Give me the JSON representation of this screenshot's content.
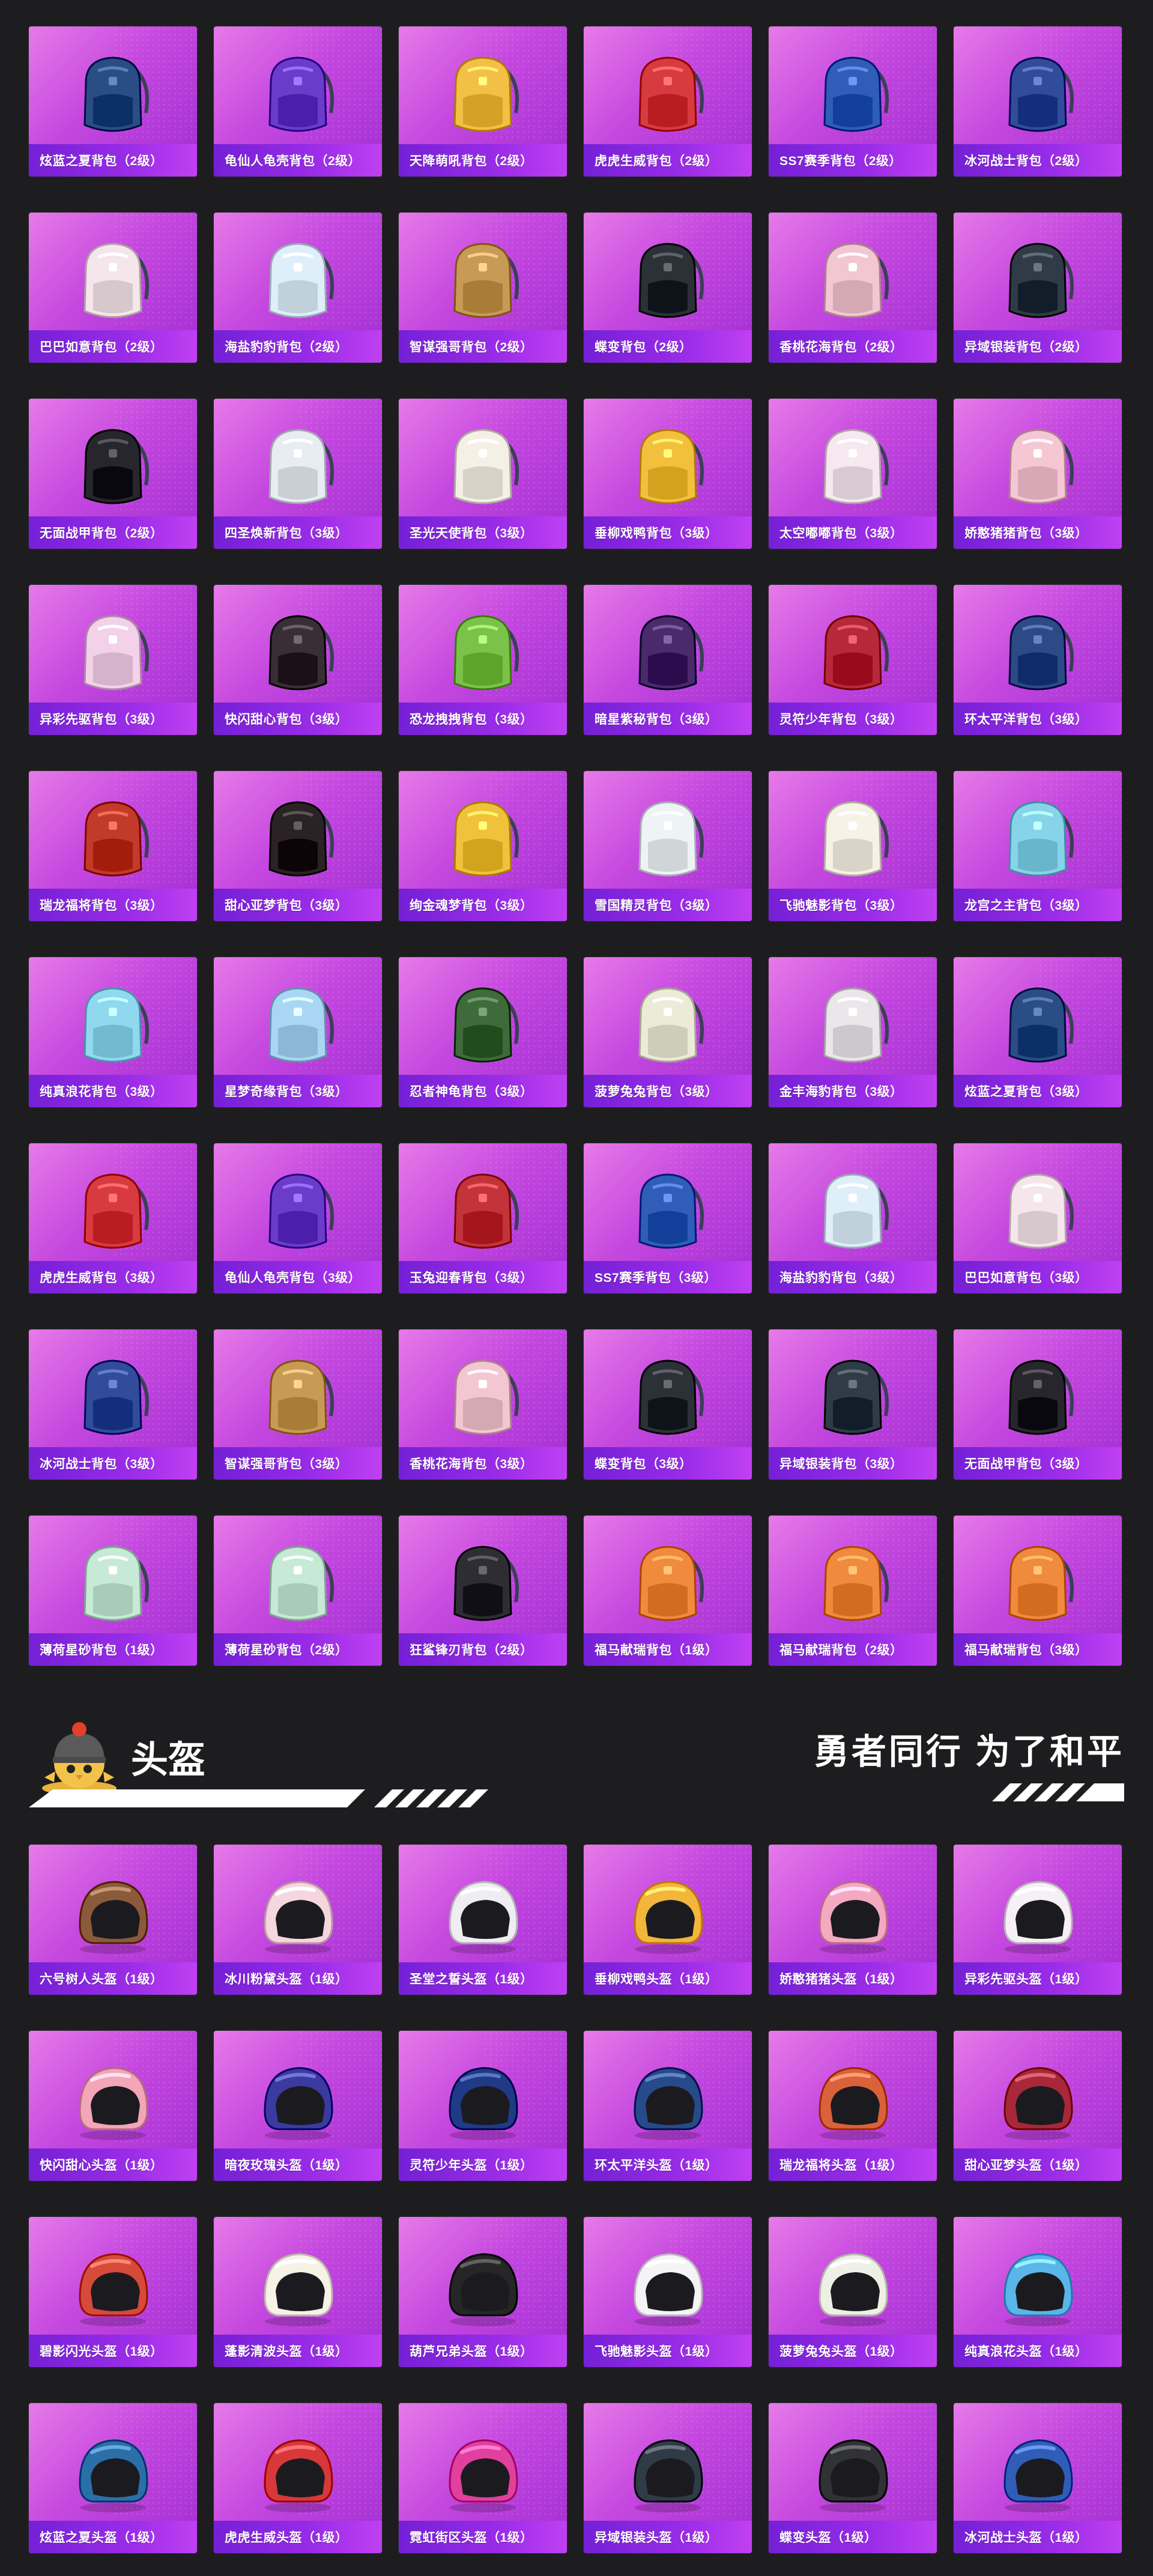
{
  "backpacks": [
    {
      "label": "炫蓝之夏背包（2级）",
      "icon": "backpack-icon",
      "color": "#2a4d86"
    },
    {
      "label": "龟仙人龟壳背包（2级）",
      "icon": "backpack-icon",
      "color": "#6a3cc9"
    },
    {
      "label": "天降萌吼背包（2级）",
      "icon": "backpack-icon",
      "color": "#f2c045"
    },
    {
      "label": "虎虎生威背包（2级）",
      "icon": "backpack-icon",
      "color": "#d83b3f"
    },
    {
      "label": "SS7赛季背包（2级）",
      "icon": "backpack-icon",
      "color": "#2f5db8"
    },
    {
      "label": "冰河战士背包（2级）",
      "icon": "backpack-icon",
      "color": "#314c9a"
    },
    {
      "label": "巴巴如意背包（2级）",
      "icon": "backpack-icon",
      "color": "#f4e6ea"
    },
    {
      "label": "海盐豹豹背包（2级）",
      "icon": "backpack-icon",
      "color": "#dfeffa"
    },
    {
      "label": "智谋强哥背包（2级）",
      "icon": "backpack-icon",
      "color": "#c79a55"
    },
    {
      "label": "蝶变背包（2级）",
      "icon": "backpack-icon",
      "color": "#2c3037"
    },
    {
      "label": "香桃花海背包（2级）",
      "icon": "backpack-icon",
      "color": "#f2c7d2"
    },
    {
      "label": "异域银装背包（2级）",
      "icon": "backpack-icon",
      "color": "#2f3b46"
    },
    {
      "label": "无面战甲背包（2级）",
      "icon": "backpack-icon",
      "color": "#26262c"
    },
    {
      "label": "四圣焕新背包（3级）",
      "icon": "backpack-icon",
      "color": "#e8ecf3"
    },
    {
      "label": "圣光天使背包（3级）",
      "icon": "backpack-icon",
      "color": "#f4f0e6"
    },
    {
      "label": "垂柳戏鸭背包（3级）",
      "icon": "backpack-icon",
      "color": "#f3c03d"
    },
    {
      "label": "太空嘟嘟背包（3级）",
      "icon": "backpack-icon",
      "color": "#f6e8ef"
    },
    {
      "label": "娇憨猪猪背包（3级）",
      "icon": "backpack-icon",
      "color": "#f5c6d3"
    },
    {
      "label": "异彩先驱背包（3级）",
      "icon": "backpack-icon",
      "color": "#f2d1e9"
    },
    {
      "label": "快闪甜心背包（3级）",
      "icon": "backpack-icon",
      "color": "#3a2e36"
    },
    {
      "label": "恐龙拽拽背包（3级）",
      "icon": "backpack-icon",
      "color": "#7bc24a"
    },
    {
      "label": "暗星紫秘背包（3级）",
      "icon": "backpack-icon",
      "color": "#4a2a6b"
    },
    {
      "label": "灵符少年背包（3级）",
      "icon": "backpack-icon",
      "color": "#b8283b"
    },
    {
      "label": "环太平洋背包（3级）",
      "icon": "backpack-icon",
      "color": "#2b4a86"
    },
    {
      "label": "瑞龙福将背包（3级）",
      "icon": "backpack-icon",
      "color": "#c13a2a"
    },
    {
      "label": "甜心亚梦背包（3级）",
      "icon": "backpack-icon",
      "color": "#2b2226"
    },
    {
      "label": "绚金魂梦背包（3级）",
      "icon": "backpack-icon",
      "color": "#f0c23c"
    },
    {
      "label": "雪国精灵背包（3级）",
      "icon": "backpack-icon",
      "color": "#eef3f6"
    },
    {
      "label": "飞驰魅影背包（3级）",
      "icon": "backpack-icon",
      "color": "#f6f2e6"
    },
    {
      "label": "龙宫之主背包（3级）",
      "icon": "backpack-icon",
      "color": "#86d3ea"
    },
    {
      "label": "纯真浪花背包（3级）",
      "icon": "backpack-icon",
      "color": "#8fd8ee"
    },
    {
      "label": "星梦奇缘背包（3级）",
      "icon": "backpack-icon",
      "color": "#a9d7f3"
    },
    {
      "label": "忍者神龟背包（3级）",
      "icon": "backpack-icon",
      "color": "#3f6a3a"
    },
    {
      "label": "菠萝兔兔背包（3级）",
      "icon": "backpack-icon",
      "color": "#ecebd8"
    },
    {
      "label": "金丰海豹背包（3级）",
      "icon": "backpack-icon",
      "color": "#eae6ea"
    },
    {
      "label": "炫蓝之夏背包（3级）",
      "icon": "backpack-icon",
      "color": "#2a4d86"
    },
    {
      "label": "虎虎生威背包（3级）",
      "icon": "backpack-icon",
      "color": "#d83b3f"
    },
    {
      "label": "龟仙人龟壳背包（3级）",
      "icon": "backpack-icon",
      "color": "#6a3cc9"
    },
    {
      "label": "玉兔迎春背包（3级）",
      "icon": "backpack-icon",
      "color": "#c2343a"
    },
    {
      "label": "SS7赛季背包（3级）",
      "icon": "backpack-icon",
      "color": "#2f5db8"
    },
    {
      "label": "海盐豹豹背包（3级）",
      "icon": "backpack-icon",
      "color": "#dfeffa"
    },
    {
      "label": "巴巴如意背包（3级）",
      "icon": "backpack-icon",
      "color": "#f4e6ea"
    },
    {
      "label": "冰河战士背包（3级）",
      "icon": "backpack-icon",
      "color": "#314c9a"
    },
    {
      "label": "智谋强哥背包（3级）",
      "icon": "backpack-icon",
      "color": "#c79a55"
    },
    {
      "label": "香桃花海背包（3级）",
      "icon": "backpack-icon",
      "color": "#f2c7d2"
    },
    {
      "label": "蝶变背包（3级）",
      "icon": "backpack-icon",
      "color": "#2c3037"
    },
    {
      "label": "异域银装背包（3级）",
      "icon": "backpack-icon",
      "color": "#2f3b46"
    },
    {
      "label": "无面战甲背包（3级）",
      "icon": "backpack-icon",
      "color": "#26262c"
    },
    {
      "label": "薄荷星砂背包（1级）",
      "icon": "backpack-icon",
      "color": "#c6ead6"
    },
    {
      "label": "薄荷星砂背包（2级）",
      "icon": "backpack-icon",
      "color": "#c6ead6"
    },
    {
      "label": "狂鲨锋刃背包（2级）",
      "icon": "backpack-icon",
      "color": "#2d2d33"
    },
    {
      "label": "福马献瑞背包（1级）",
      "icon": "backpack-icon",
      "color": "#f08a3c"
    },
    {
      "label": "福马献瑞背包（2级）",
      "icon": "backpack-icon",
      "color": "#f08a3c"
    },
    {
      "label": "福马献瑞背包（3级）",
      "icon": "backpack-icon",
      "color": "#f08a3c"
    }
  ],
  "helmet_section": {
    "title": "头盔",
    "slogan": "勇者同行 为了和平",
    "mascot_icon": "chick-helmet-mascot-icon"
  },
  "helmets": [
    {
      "label": "六号树人头盔（1级）",
      "icon": "helmet-icon",
      "color": "#8a5a3a"
    },
    {
      "label": "冰川粉黛头盔（1级）",
      "icon": "helmet-icon",
      "color": "#f6d6de"
    },
    {
      "label": "圣堂之誓头盔（1级）",
      "icon": "helmet-icon",
      "color": "#eeeef2"
    },
    {
      "label": "垂柳戏鸭头盔（1级）",
      "icon": "helmet-icon",
      "color": "#f3b53a"
    },
    {
      "label": "娇憨猪猪头盔（1级）",
      "icon": "helmet-icon",
      "color": "#f4a9c0"
    },
    {
      "label": "异彩先驱头盔（1级）",
      "icon": "helmet-icon",
      "color": "#f4f0f4"
    },
    {
      "label": "快闪甜心头盔（1级）",
      "icon": "helmet-icon",
      "color": "#f2a6b8"
    },
    {
      "label": "暗夜玫瑰头盔（1级）",
      "icon": "helmet-icon",
      "color": "#3b3aa0"
    },
    {
      "label": "灵符少年头盔（1级）",
      "icon": "helmet-icon",
      "color": "#1f3a86"
    },
    {
      "label": "环太平洋头盔（1级）",
      "icon": "helmet-icon",
      "color": "#274a8a"
    },
    {
      "label": "瑞龙福将头盔（1级）",
      "icon": "helmet-icon",
      "color": "#d9623a"
    },
    {
      "label": "甜心亚梦头盔（1级）",
      "icon": "helmet-icon",
      "color": "#a8283a"
    },
    {
      "label": "碧影闪光头盔（1级）",
      "icon": "helmet-icon",
      "color": "#d64a3a"
    },
    {
      "label": "蓬影清波头盔（1级）",
      "icon": "helmet-icon",
      "color": "#f6f2e6"
    },
    {
      "label": "葫芦兄弟头盔（1级）",
      "icon": "helmet-icon",
      "color": "#262626"
    },
    {
      "label": "飞驰魅影头盔（1级）",
      "icon": "helmet-icon",
      "color": "#f4f4f6"
    },
    {
      "label": "菠萝兔兔头盔（1级）",
      "icon": "helmet-icon",
      "color": "#eef0e6"
    },
    {
      "label": "纯真浪花头盔（1级）",
      "icon": "helmet-icon",
      "color": "#5ab6e8"
    },
    {
      "label": "炫蓝之夏头盔（1级）",
      "icon": "helmet-icon",
      "color": "#2b6fa8"
    },
    {
      "label": "虎虎生威头盔（1级）",
      "icon": "helmet-icon",
      "color": "#d8383a"
    },
    {
      "label": "霓虹街区头盔（1级）",
      "icon": "helmet-icon",
      "color": "#e0409e"
    },
    {
      "label": "异域银装头盔（1级）",
      "icon": "helmet-icon",
      "color": "#2f3b46"
    },
    {
      "label": "蝶变头盔（1级）",
      "icon": "helmet-icon",
      "color": "#303236"
    },
    {
      "label": "冰河战士头盔（1级）",
      "icon": "helmet-icon",
      "color": "#2f5db8"
    }
  ]
}
